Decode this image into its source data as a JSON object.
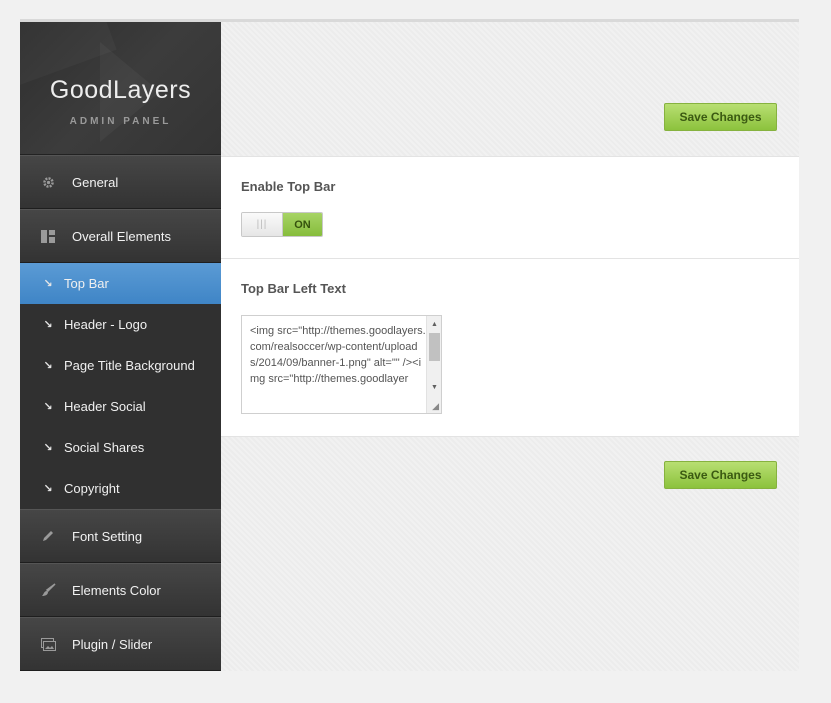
{
  "brand": {
    "title": "GoodLayers",
    "subtitle": "ADMIN PANEL"
  },
  "sidebar": {
    "sections_top": [
      {
        "label": "General",
        "icon": "gear-icon"
      },
      {
        "label": "Overall Elements",
        "icon": "layout-icon"
      }
    ],
    "sub_items": [
      {
        "label": "Top Bar",
        "icon": "arrow-down-right-icon",
        "active": true
      },
      {
        "label": "Header - Logo",
        "icon": "arrow-down-right-icon"
      },
      {
        "label": "Page Title Background",
        "icon": "arrow-down-right-icon"
      },
      {
        "label": "Header Social",
        "icon": "arrow-down-right-icon"
      },
      {
        "label": "Social Shares",
        "icon": "arrow-down-right-icon"
      },
      {
        "label": "Copyright",
        "icon": "arrow-down-right-icon"
      }
    ],
    "sections_bottom": [
      {
        "label": "Font Setting",
        "icon": "pencil-icon"
      },
      {
        "label": "Elements Color",
        "icon": "brush-icon"
      },
      {
        "label": "Plugin / Slider",
        "icon": "slider-icon"
      }
    ]
  },
  "actions": {
    "save_label": "Save Changes"
  },
  "options": {
    "enable_top_bar": {
      "title": "Enable Top Bar",
      "toggle_handle": "|||",
      "toggle_state": "ON"
    },
    "top_bar_left_text": {
      "title": "Top Bar Left Text",
      "value": "<img src=\"http://themes.goodlayers.com/realsoccer/wp-content/uploads/2014/09/banner-1.png\" alt=\"\" /><img src=\"http://themes.goodlayer"
    }
  },
  "colors": {
    "accent_blue": "#4a90cf",
    "save_green": "#9fcf52",
    "sidebar_dark": "#3a3a3a"
  }
}
